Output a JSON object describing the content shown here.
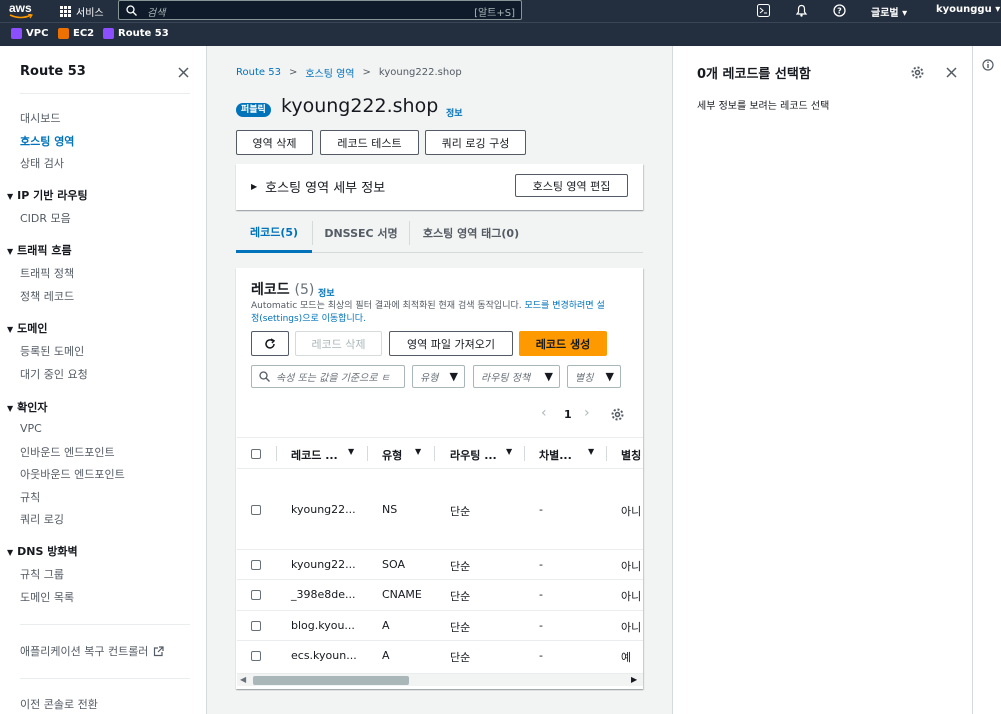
{
  "topbar": {
    "logo": "aws",
    "services": "서비스",
    "search_placeholder": "검색",
    "search_shortcut": "[알트+S]",
    "region": "글로벌",
    "account": "kyounggu"
  },
  "favorites": [
    {
      "label": "VPC",
      "color": "#8c4fff"
    },
    {
      "label": "EC2",
      "color": "#ed7100"
    },
    {
      "label": "Route 53",
      "color": "#8c4fff"
    }
  ],
  "sidebar": {
    "title": "Route 53",
    "items": [
      {
        "label": "대시보드",
        "type": "item"
      },
      {
        "label": "호스팅 영역",
        "type": "active"
      },
      {
        "label": "상태 검사",
        "type": "item"
      },
      {
        "label": "IP 기반 라우팅",
        "type": "group"
      },
      {
        "label": "CIDR 모음",
        "type": "item"
      },
      {
        "label": "트래픽 흐름",
        "type": "group"
      },
      {
        "label": "트래픽 정책",
        "type": "item"
      },
      {
        "label": "정책 레코드",
        "type": "item"
      },
      {
        "label": "도메인",
        "type": "group"
      },
      {
        "label": "등록된 도메인",
        "type": "item"
      },
      {
        "label": "대기 중인 요청",
        "type": "item"
      },
      {
        "label": "확인자",
        "type": "group"
      },
      {
        "label": "VPC",
        "type": "item"
      },
      {
        "label": "인바운드 엔드포인트",
        "type": "item"
      },
      {
        "label": "아웃바운드 엔드포인트",
        "type": "item"
      },
      {
        "label": "규칙",
        "type": "item"
      },
      {
        "label": "쿼리 로깅",
        "type": "item"
      },
      {
        "label": "DNS 방화벽",
        "type": "group"
      },
      {
        "label": "규칙 그룹",
        "type": "item"
      },
      {
        "label": "도메인 목록",
        "type": "item"
      }
    ],
    "arc_link": "애플리케이션 복구 컨트롤러",
    "old_console": "이전 콘솔로 전환"
  },
  "breadcrumb": [
    "Route 53",
    "호스팅 영역",
    "kyoung222.shop"
  ],
  "page": {
    "badge": "퍼블릭",
    "title": "kyoung222.shop",
    "info": "정보"
  },
  "actions": [
    "영역 삭제",
    "레코드 테스트",
    "쿼리 로깅 구성"
  ],
  "details": {
    "title": "호스팅 영역 세부 정보",
    "edit": "호스팅 영역 편집"
  },
  "tabs": [
    "레코드(5)",
    "DNSSEC 서명",
    "호스팅 영역 태그(0)"
  ],
  "records": {
    "title": "레코드",
    "count": "(5)",
    "info": "정보",
    "desc_plain": "Automatic 모드는 최상의 필터 결과에 최적화된 현재 검색 동작입니다. ",
    "desc_link1": "모드를 변경하려면 설",
    "desc_link2": "정(settings)으로 이동합니다.",
    "delete": "레코드 삭제",
    "import": "영역 파일 가져오기",
    "create": "레코드 생성",
    "filter_placeholder": "속성 또는 값을 기준으로 ㅌ",
    "filters": [
      "유형",
      "라우팅 정책",
      "별칭"
    ],
    "page": "1",
    "columns": [
      "레코드 ...",
      "유형",
      "라우팅 ...",
      "차별...",
      "별칭"
    ],
    "rows": [
      {
        "name": "kyoung22...",
        "type": "NS",
        "routing": "단순",
        "diff": "-",
        "alias": "아니"
      },
      {
        "name": "kyoung22...",
        "type": "SOA",
        "routing": "단순",
        "diff": "-",
        "alias": "아니"
      },
      {
        "name": "_398e8de...",
        "type": "CNAME",
        "routing": "단순",
        "diff": "-",
        "alias": "아니"
      },
      {
        "name": "blog.kyou...",
        "type": "A",
        "routing": "단순",
        "diff": "-",
        "alias": "아니"
      },
      {
        "name": "ecs.kyoun...",
        "type": "A",
        "routing": "단순",
        "diff": "-",
        "alias": "예"
      }
    ]
  },
  "right_panel": {
    "title": "0개 레코드를 선택함",
    "desc": "세부 정보를 보려는 레코드 선택"
  }
}
